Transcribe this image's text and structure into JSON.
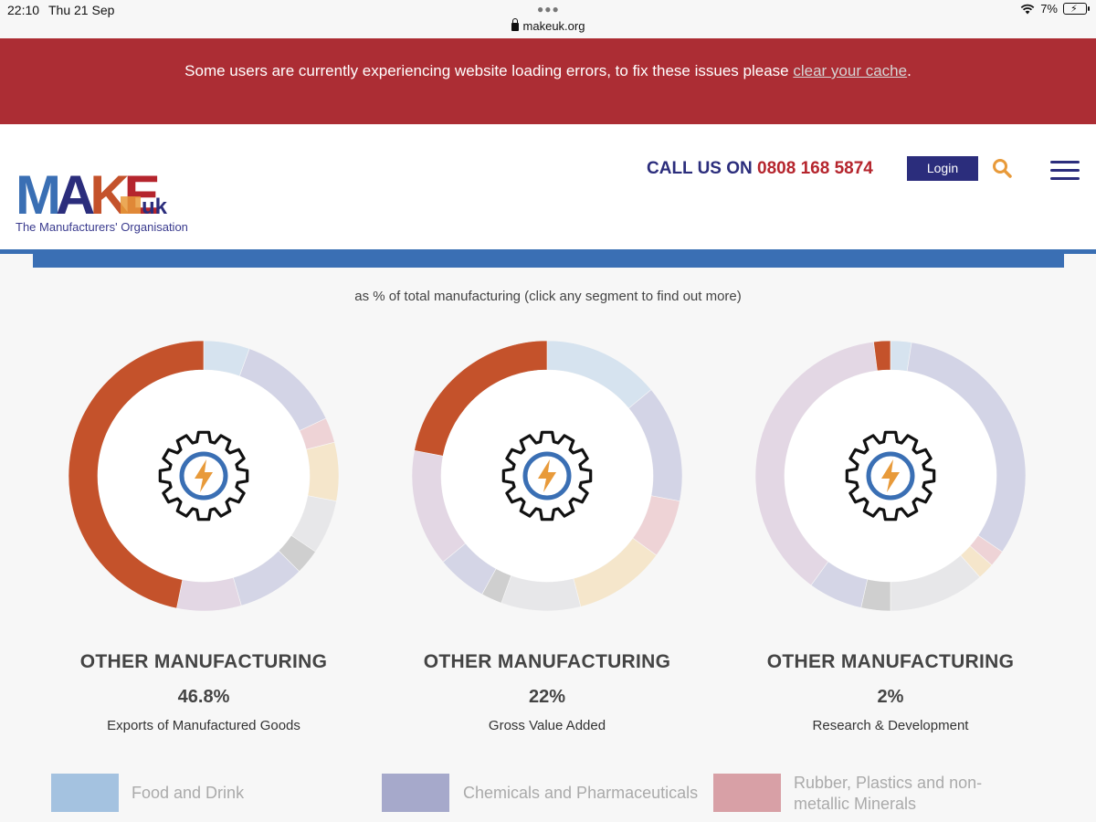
{
  "status_bar": {
    "time": "22:10",
    "date": "Thu 21 Sep",
    "url": "makeuk.org",
    "battery": "7%"
  },
  "banner": {
    "text": "Some users are currently experiencing website loading errors, to fix these issues please ",
    "link": "clear your cache",
    "end": "."
  },
  "header": {
    "logo_main": "MAKE",
    "logo_suffix": "uk",
    "logo_sub": "The Manufacturers' Organisation",
    "call_label": "CALL US ON",
    "call_number": "0808 168 5874",
    "login_label": "Login"
  },
  "subtitle": "as % of total manufacturing (click any segment to find out more)",
  "panels": [
    {
      "title": "OTHER MANUFACTURING",
      "value": "46.8%",
      "label": "Exports of Manufactured Goods"
    },
    {
      "title": "OTHER MANUFACTURING",
      "value": "22%",
      "label": "Gross Value Added"
    },
    {
      "title": "OTHER MANUFACTURING",
      "value": "2%",
      "label": "Research & Development"
    }
  ],
  "legend": [
    {
      "label": "Food and Drink",
      "color": "#a4c2e0"
    },
    {
      "label": "Chemicals and Pharmaceuticals",
      "color": "#a6a9cb"
    },
    {
      "label": "Rubber, Plastics and non-metallic Minerals",
      "color": "#d8a0a6"
    }
  ],
  "chart_data": [
    {
      "type": "pie",
      "title": "Exports of Manufactured Goods",
      "highlight": "Other Manufacturing",
      "highlight_value": 46.8,
      "segments": [
        {
          "value": 5.5,
          "color": "#d6e3ef"
        },
        {
          "value": 12.5,
          "color": "#d3d4e6"
        },
        {
          "value": 3,
          "color": "#eed3d6"
        },
        {
          "value": 7,
          "color": "#f5e6cb"
        },
        {
          "value": 6.5,
          "color": "#e7e7e9"
        },
        {
          "value": 3,
          "color": "#cfcfcf"
        },
        {
          "value": 8,
          "color": "#d4d5e6"
        },
        {
          "value": 7.7,
          "color": "#e3d7e4"
        },
        {
          "value": 46.8,
          "color": "#c4522b"
        }
      ]
    },
    {
      "type": "pie",
      "title": "Gross Value Added",
      "highlight": "Other Manufacturing",
      "highlight_value": 22,
      "segments": [
        {
          "value": 14,
          "color": "#d6e3ef"
        },
        {
          "value": 14,
          "color": "#d3d4e6"
        },
        {
          "value": 7,
          "color": "#eed3d6"
        },
        {
          "value": 11,
          "color": "#f5e6cb"
        },
        {
          "value": 9.5,
          "color": "#e7e7e9"
        },
        {
          "value": 2.5,
          "color": "#cfcfcf"
        },
        {
          "value": 6,
          "color": "#d4d5e6"
        },
        {
          "value": 14,
          "color": "#e3d7e4"
        },
        {
          "value": 22,
          "color": "#c4522b"
        }
      ]
    },
    {
      "type": "pie",
      "title": "Research & Development",
      "highlight": "Other Manufacturing",
      "highlight_value": 2,
      "segments": [
        {
          "value": 2.5,
          "color": "#d6e3ef"
        },
        {
          "value": 32,
          "color": "#d3d4e6"
        },
        {
          "value": 2,
          "color": "#eed3d6"
        },
        {
          "value": 2,
          "color": "#f5e6cb"
        },
        {
          "value": 11.5,
          "color": "#e7e7e9"
        },
        {
          "value": 3.5,
          "color": "#cfcfcf"
        },
        {
          "value": 6.5,
          "color": "#d4d5e6"
        },
        {
          "value": 38,
          "color": "#e3d7e4"
        },
        {
          "value": 2,
          "color": "#c4522b"
        }
      ]
    }
  ]
}
